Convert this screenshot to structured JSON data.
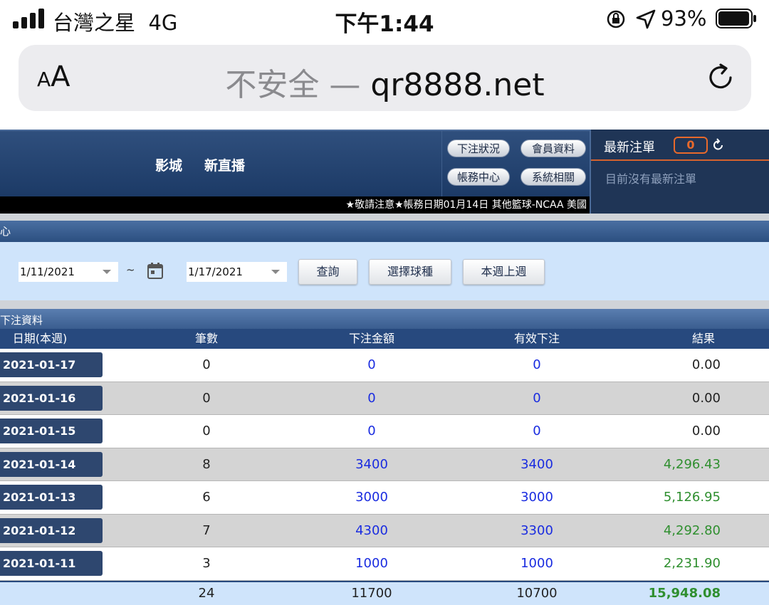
{
  "status": {
    "carrier": "台灣之星",
    "network": "4G",
    "time": "下午1:44",
    "battery": "93%"
  },
  "browser": {
    "text_size": "AA",
    "insecure": "不安全 —",
    "domain": "qr8888.net"
  },
  "header": {
    "nav": [
      "影城",
      "新直播"
    ],
    "buttons": [
      "下注狀況",
      "會員資料",
      "帳務中心",
      "系統相關"
    ],
    "ticker": "★敬請注意★帳務日期01月14日  其他籃球-NCAA  美國"
  },
  "latest": {
    "title": "最新注單",
    "count": "0",
    "empty": "目前沒有最新注單"
  },
  "section": {
    "title": "心"
  },
  "filter": {
    "from": "1/11/2021",
    "tilde": "~",
    "to": "1/17/2021",
    "query": "查詢",
    "sport": "選擇球種",
    "week": "本週上週"
  },
  "table": {
    "title": "下注資料",
    "headers": [
      "日期(本週)",
      "筆數",
      "下注金額",
      "有效下注",
      "結果"
    ],
    "rows": [
      {
        "date": "2021-01-17",
        "count": "0",
        "bet": "0",
        "valid": "0",
        "result": "0.00"
      },
      {
        "date": "2021-01-16",
        "count": "0",
        "bet": "0",
        "valid": "0",
        "result": "0.00"
      },
      {
        "date": "2021-01-15",
        "count": "0",
        "bet": "0",
        "valid": "0",
        "result": "0.00"
      },
      {
        "date": "2021-01-14",
        "count": "8",
        "bet": "3400",
        "valid": "3400",
        "result": "4,296.43"
      },
      {
        "date": "2021-01-13",
        "count": "6",
        "bet": "3000",
        "valid": "3000",
        "result": "5,126.95"
      },
      {
        "date": "2021-01-12",
        "count": "7",
        "bet": "4300",
        "valid": "3300",
        "result": "4,292.80"
      },
      {
        "date": "2021-01-11",
        "count": "3",
        "bet": "1000",
        "valid": "1000",
        "result": "2,231.90"
      }
    ],
    "total": {
      "count": "24",
      "bet": "11700",
      "valid": "10700",
      "result": "15,948.08"
    }
  },
  "colors": {
    "header_blue": "#1c3a66",
    "link_blue": "#1a2ce0",
    "profit_green": "#2f8f2f",
    "accent_orange": "#e8692b"
  }
}
